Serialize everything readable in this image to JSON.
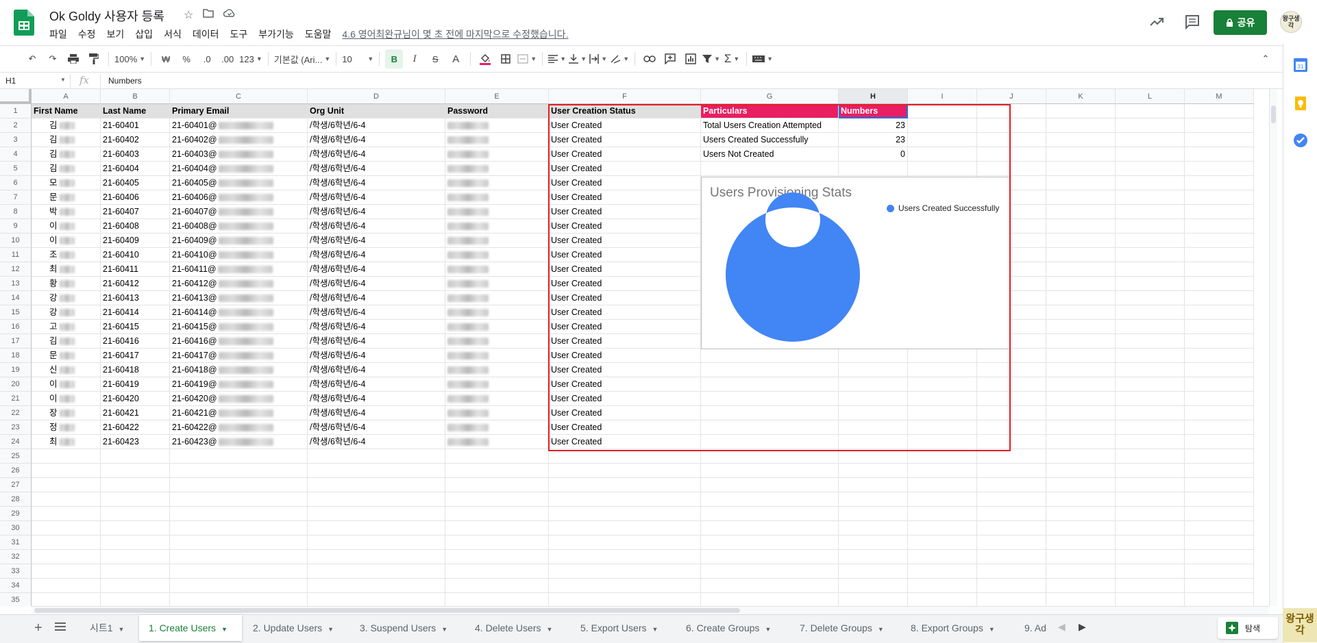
{
  "app": {
    "doc_title": "Ok Goldy 사용자 등록",
    "menus": [
      "파일",
      "수정",
      "보기",
      "삽입",
      "서식",
      "데이터",
      "도구",
      "부가기능",
      "도움말"
    ],
    "last_edit": "4.6 영어최완규님이 몇 초 전에 마지막으로 수정했습니다.",
    "share_label": "공유",
    "avatar_text": "왕구생각"
  },
  "toolbar": {
    "zoom": "100%",
    "currency": "₩",
    "percent": "%",
    "dec_less": ".0",
    "dec_more": ".00",
    "more_formats": "123",
    "font": "기본값 (Ari...",
    "font_size": "10",
    "bold": "B",
    "italic": "I",
    "strike": "S",
    "text_color": "A"
  },
  "formula_bar": {
    "cell_ref": "H1",
    "fx": "fx",
    "value": "Numbers"
  },
  "columns": [
    "A",
    "B",
    "C",
    "D",
    "E",
    "F",
    "G",
    "H",
    "I",
    "J",
    "K",
    "L",
    "M"
  ],
  "selected_column": "H",
  "row_numbers": [
    "1",
    "2",
    "3",
    "4",
    "5",
    "6",
    "7",
    "8",
    "9",
    "10",
    "11",
    "12",
    "13",
    "14",
    "15",
    "16",
    "17",
    "18",
    "19",
    "20",
    "21",
    "22",
    "23",
    "24",
    "25",
    "26",
    "27",
    "28",
    "29",
    "30",
    "31",
    "32",
    "33",
    "34",
    "35"
  ],
  "headers": {
    "first_name": "First Name",
    "last_name": "Last Name",
    "email": "Primary Email",
    "org_unit": "Org Unit",
    "password": "Password",
    "status": "User Creation Status",
    "particulars": "Particulars",
    "numbers": "Numbers"
  },
  "rows": [
    {
      "first": "김",
      "last": "21-60401",
      "email": "21-60401@",
      "org": "/학생/6학년/6-4",
      "status": "User Created"
    },
    {
      "first": "김",
      "last": "21-60402",
      "email": "21-60402@",
      "org": "/학생/6학년/6-4",
      "status": "User Created"
    },
    {
      "first": "김",
      "last": "21-60403",
      "email": "21-60403@",
      "org": "/학생/6학년/6-4",
      "status": "User Created"
    },
    {
      "first": "김",
      "last": "21-60404",
      "email": "21-60404@",
      "org": "/학생/6학년/6-4",
      "status": "User Created"
    },
    {
      "first": "모",
      "last": "21-60405",
      "email": "21-60405@",
      "org": "/학생/6학년/6-4",
      "status": "User Created"
    },
    {
      "first": "문",
      "last": "21-60406",
      "email": "21-60406@",
      "org": "/학생/6학년/6-4",
      "status": "User Created"
    },
    {
      "first": "박",
      "last": "21-60407",
      "email": "21-60407@",
      "org": "/학생/6학년/6-4",
      "status": "User Created"
    },
    {
      "first": "이",
      "last": "21-60408",
      "email": "21-60408@",
      "org": "/학생/6학년/6-4",
      "status": "User Created"
    },
    {
      "first": "이",
      "last": "21-60409",
      "email": "21-60409@",
      "org": "/학생/6학년/6-4",
      "status": "User Created"
    },
    {
      "first": "조",
      "last": "21-60410",
      "email": "21-60410@",
      "org": "/학생/6학년/6-4",
      "status": "User Created"
    },
    {
      "first": "최",
      "last": "21-60411",
      "email": "21-60411@",
      "org": "/학생/6학년/6-4",
      "status": "User Created"
    },
    {
      "first": "황",
      "last": "21-60412",
      "email": "21-60412@",
      "org": "/학생/6학년/6-4",
      "status": "User Created"
    },
    {
      "first": "강",
      "last": "21-60413",
      "email": "21-60413@",
      "org": "/학생/6학년/6-4",
      "status": "User Created"
    },
    {
      "first": "강",
      "last": "21-60414",
      "email": "21-60414@",
      "org": "/학생/6학년/6-4",
      "status": "User Created"
    },
    {
      "first": "고",
      "last": "21-60415",
      "email": "21-60415@",
      "org": "/학생/6학년/6-4",
      "status": "User Created"
    },
    {
      "first": "김",
      "last": "21-60416",
      "email": "21-60416@",
      "org": "/학생/6학년/6-4",
      "status": "User Created"
    },
    {
      "first": "문",
      "last": "21-60417",
      "email": "21-60417@",
      "org": "/학생/6학년/6-4",
      "status": "User Created"
    },
    {
      "first": "신",
      "last": "21-60418",
      "email": "21-60418@",
      "org": "/학생/6학년/6-4",
      "status": "User Created"
    },
    {
      "first": "이",
      "last": "21-60419",
      "email": "21-60419@",
      "org": "/학생/6학년/6-4",
      "status": "User Created"
    },
    {
      "first": "이",
      "last": "21-60420",
      "email": "21-60420@",
      "org": "/학생/6학년/6-4",
      "status": "User Created"
    },
    {
      "first": "장",
      "last": "21-60421",
      "email": "21-60421@",
      "org": "/학생/6학년/6-4",
      "status": "User Created"
    },
    {
      "first": "정",
      "last": "21-60422",
      "email": "21-60422@",
      "org": "/학생/6학년/6-4",
      "status": "User Created"
    },
    {
      "first": "최",
      "last": "21-60423",
      "email": "21-60423@",
      "org": "/학생/6학년/6-4",
      "status": "User Created"
    }
  ],
  "stats": [
    {
      "label": "Total Users Creation Attempted",
      "value": "23"
    },
    {
      "label": "Users Created Successfully",
      "value": "23"
    },
    {
      "label": "Users Not Created",
      "value": "0"
    }
  ],
  "chart_data": {
    "type": "pie",
    "title": "Users Provisioning Stats",
    "donut": true,
    "legend_position": "top-right",
    "categories": [
      "Users Created Successfully",
      "Users Not Created"
    ],
    "values": [
      23,
      0
    ],
    "colors": [
      "#4285f4",
      "#ea4335"
    ],
    "legend_entries": [
      "Users Created Successfully"
    ]
  },
  "sheet_tabs": [
    "시트1",
    "1. Create Users",
    "2. Update Users",
    "3. Suspend Users",
    "4. Delete Users",
    "5. Export Users",
    "6. Create Groups",
    "7. Delete Groups",
    "8. Export Groups",
    "9. Ad"
  ],
  "active_tab": "1. Create Users",
  "explore_label": "탐색",
  "watermark": "왕구생각",
  "colors": {
    "brand_green": "#188038",
    "particulars_header": "#e91e63",
    "numbers_header": "#e91e63",
    "highlight_box": "#e51c23",
    "chart_blue": "#4285f4"
  }
}
